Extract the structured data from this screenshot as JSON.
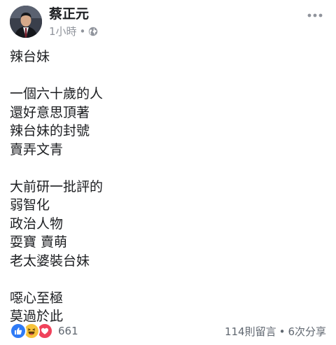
{
  "post": {
    "author": "蔡正元",
    "timestamp": "1小時",
    "separator": "•",
    "privacy_icon": "globe-icon",
    "more_icon": "more-horizontal-icon",
    "body_lines": [
      "辣台妹",
      "",
      "一個六十歲的人",
      "還好意思頂著",
      "辣台妹的封號",
      "賣弄文青",
      "",
      "大前研一批評的",
      "弱智化",
      "政治人物",
      "耍寶 賣萌",
      "老太婆裝台妹",
      "",
      "噁心至極",
      "莫過於此"
    ]
  },
  "footer": {
    "reaction_icons": [
      "like-icon",
      "haha-icon",
      "love-icon"
    ],
    "reaction_count": "661",
    "comments": "114則留言",
    "separator": "•",
    "shares": "6次分享"
  }
}
